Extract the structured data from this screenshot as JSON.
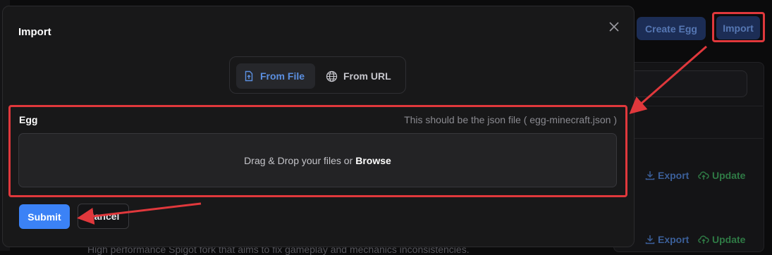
{
  "background": {
    "create_egg_label": "Create Egg",
    "import_label": "Import",
    "rows": [
      {
        "export_label": "Export",
        "update_label": "Update"
      },
      {
        "export_label": "Export",
        "update_label": "Update"
      }
    ],
    "description": "High performance Spigot fork that aims to fix gameplay and mechanics inconsistencies."
  },
  "modal": {
    "title": "Import",
    "tabs": [
      {
        "label": "From File",
        "icon": "file-upload-icon",
        "active": true
      },
      {
        "label": "From URL",
        "icon": "globe-icon",
        "active": false
      }
    ],
    "field": {
      "label": "Egg",
      "hint": "This should be the json file ( egg-minecraft.json )"
    },
    "dropzone": {
      "text": "Drag & Drop your files or",
      "browse_label": "Browse"
    },
    "submit_label": "Submit",
    "cancel_label": "Cancel"
  },
  "colors": {
    "accent": "#3b82f6",
    "annotation": "#e0383c",
    "export": "#3b5f99",
    "update": "#2f7a45"
  }
}
